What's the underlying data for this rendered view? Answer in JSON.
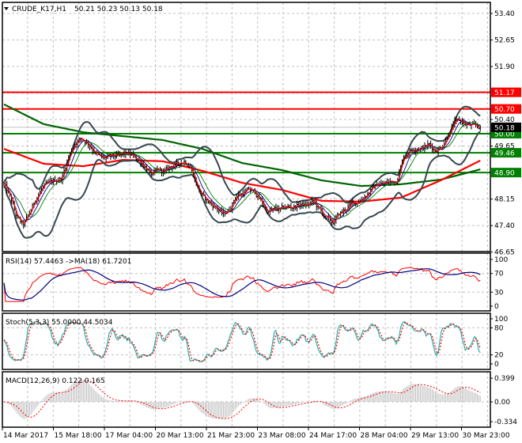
{
  "header": {
    "symbol": "CRUDE_K17,H1",
    "ohlc": "50.21 50.23 50.13 50.18",
    "menu_icon": "triangle-down-icon"
  },
  "colors": {
    "bars": "#000000",
    "bollinger": "#37474f",
    "ma_fast": "#ff0000",
    "ma_mid": "#00008b",
    "ma_slow_thin": "#008000",
    "ma_long_red": "#ff0000",
    "ma_long_green": "#006400",
    "resistance": "#ff0000",
    "support": "#008000",
    "rsi": "#ff0000",
    "rsi_ma": "#000080",
    "stoch_main": "#20b2aa",
    "stoch_signal": "#ff0000",
    "macd_hist": "#c0c0c0",
    "macd_signal": "#ff0000",
    "grid": "#c0c0c0"
  },
  "chart_data": [
    {
      "type": "ohlc",
      "panel": "main",
      "title": "CRUDE_K17,H1",
      "ylim": [
        46.65,
        53.7
      ],
      "y_ticks": [
        "53.40",
        "52.65",
        "51.90",
        "50.40",
        "49.65",
        "48.15",
        "47.40",
        "46.65"
      ],
      "current_price": "50.18",
      "levels": [
        {
          "value": 51.17,
          "label": "51.17",
          "kind": "resistance"
        },
        {
          "value": 50.7,
          "label": "50.70",
          "kind": "resistance"
        },
        {
          "value": 50.0,
          "label": "50.00",
          "kind": "support"
        },
        {
          "value": 49.46,
          "label": "49.46",
          "kind": "support"
        },
        {
          "value": 48.9,
          "label": "48.90",
          "kind": "support"
        }
      ],
      "close_path": [
        48.57,
        48.19,
        47.63,
        47.4,
        47.74,
        48.19,
        48.48,
        48.57,
        48.68,
        48.75,
        49.31,
        49.75,
        49.87,
        49.75,
        49.53,
        49.31,
        49.31,
        49.35,
        49.37,
        49.42,
        49.37,
        49.24,
        49.08,
        48.81,
        48.97,
        48.91,
        49.08,
        49.13,
        49.24,
        49.08,
        48.52,
        48.19,
        48.03,
        47.92,
        47.7,
        47.85,
        48.23,
        48.3,
        48.41,
        48.34,
        48.08,
        47.78,
        47.85,
        47.85,
        47.92,
        47.92,
        48.01,
        47.96,
        48.08,
        47.85,
        47.63,
        47.47,
        47.7,
        47.85,
        48.01,
        48.08,
        48.23,
        48.41,
        48.57,
        48.59,
        48.63,
        48.68,
        49.31,
        49.53,
        49.62,
        49.6,
        49.69,
        49.53,
        49.64,
        49.98,
        50.31,
        50.36,
        50.24,
        50.2,
        50.18
      ],
      "ma_long_green": [
        50.83,
        50.27,
        50.04,
        49.93,
        49.82,
        49.57,
        49.17,
        48.97,
        48.68,
        48.52,
        48.57,
        48.7,
        48.99
      ],
      "ma_long_red": [
        49.57,
        49.15,
        49.08,
        49.26,
        49.22,
        48.95,
        48.61,
        48.41,
        48.1,
        48.08,
        48.19,
        48.68,
        49.24
      ]
    },
    {
      "type": "line",
      "panel": "rsi",
      "label": "RSI(14) 57.4463  ->MA(18) 61.7201",
      "ylim": [
        0,
        100
      ],
      "y_ticks": [
        "100",
        "70",
        "30",
        "0"
      ]
    },
    {
      "type": "line",
      "panel": "stochastic",
      "label": "Stoch(5,3,3) 55.0000 44.5034",
      "ylim": [
        0,
        100
      ],
      "y_ticks": [
        "100",
        "80",
        "20",
        "0"
      ]
    },
    {
      "type": "bar",
      "panel": "macd",
      "label": "MACD(12,26,9) 0.122 0.165",
      "ylim": [
        -0.334,
        0.399
      ],
      "y_ticks": [
        "0.399",
        "0.00",
        "-0.334"
      ]
    }
  ],
  "time_axis": [
    "14 Mar 2017",
    "15 Mar 18:00",
    "17 Mar 04:00",
    "20 Mar 13:00",
    "21 Mar 23:00",
    "23 Mar 08:00",
    "24 Mar 17:00",
    "28 Mar 04:00",
    "29 Mar 13:00",
    "30 Mar 23:00"
  ]
}
